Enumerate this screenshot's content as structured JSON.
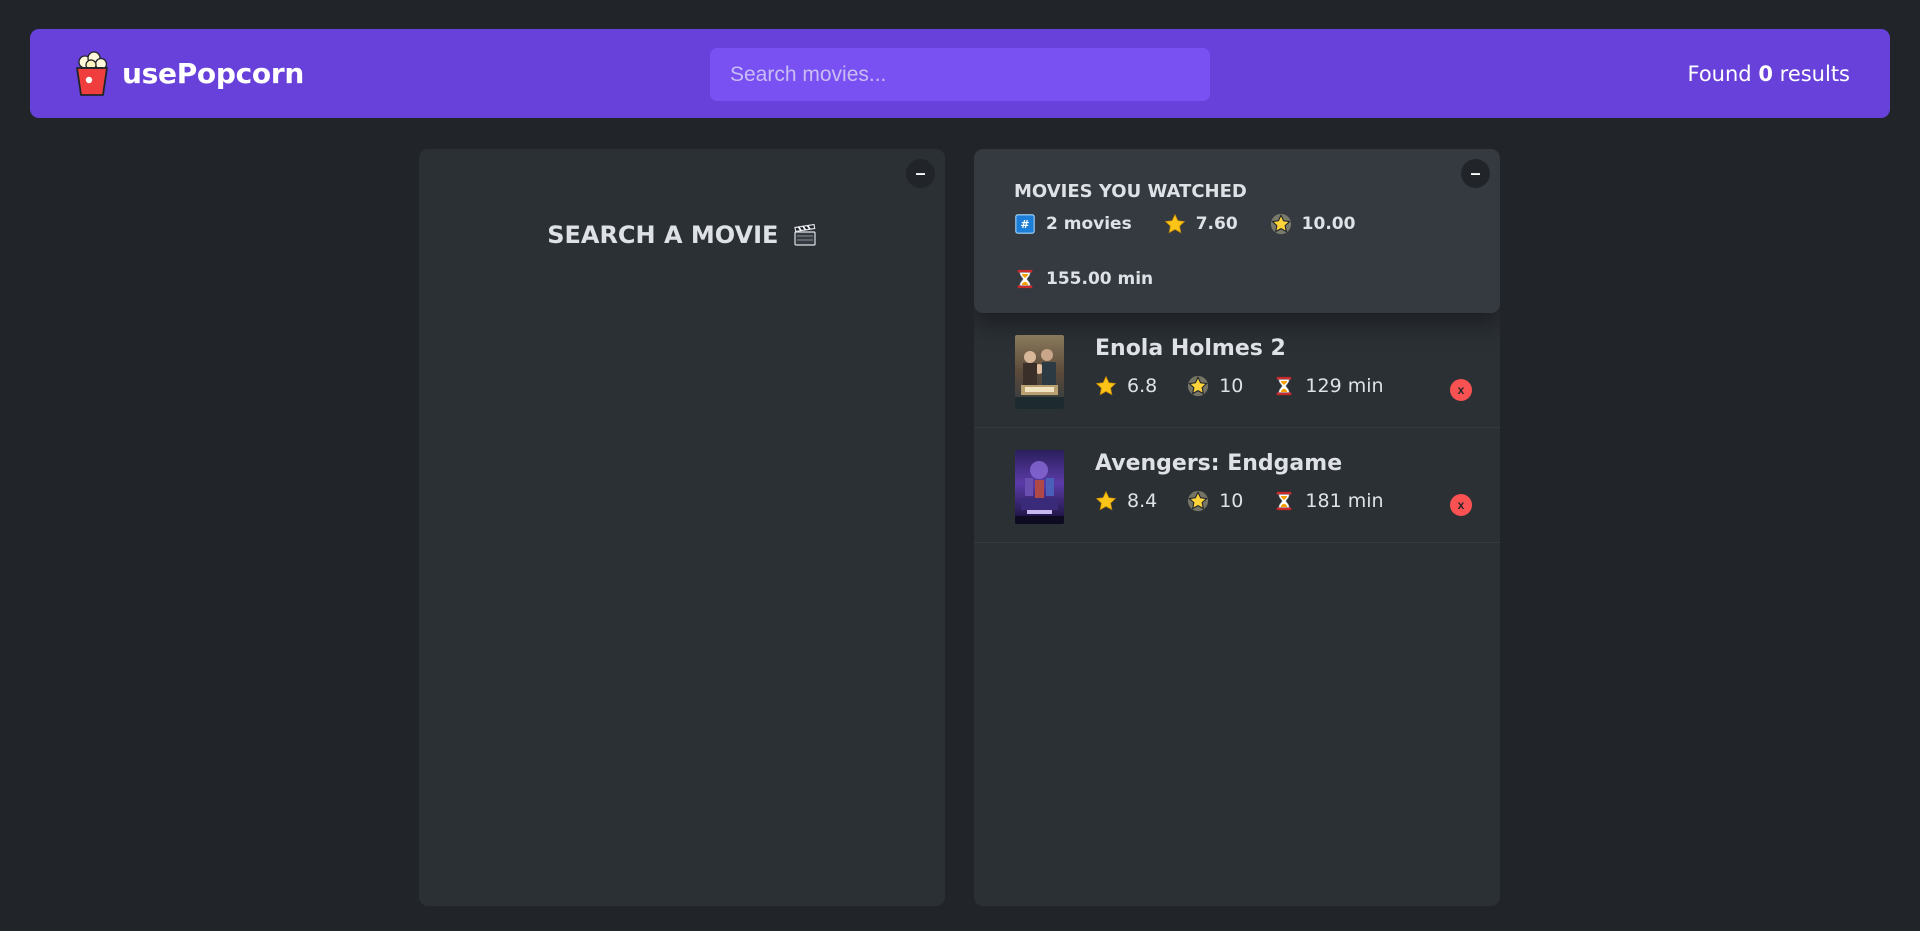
{
  "nav": {
    "logo_text": "usePopcorn",
    "search_placeholder": "Search movies...",
    "results_prefix": "Found",
    "results_count": "0",
    "results_suffix": "results"
  },
  "left_box": {
    "toggle_label": "–",
    "title": "SEARCH A MOVIE"
  },
  "right_box": {
    "toggle_label": "–",
    "summary": {
      "heading": "Movies you watched",
      "num_movies": "2 movies",
      "avg_imdb_rating": "7.60",
      "avg_user_rating": "10.00",
      "avg_runtime": "155.00 min"
    },
    "movies": [
      {
        "title": "Enola Holmes 2",
        "imdb_rating": "6.8",
        "user_rating": "10",
        "runtime": "129 min",
        "delete_label": "x"
      },
      {
        "title": "Avengers: Endgame",
        "imdb_rating": "8.4",
        "user_rating": "10",
        "runtime": "181 min",
        "delete_label": "x"
      }
    ]
  },
  "icons": {
    "logo": "popcorn-icon",
    "clapper": "clapper-board-icon",
    "count": "hash-icon",
    "imdb_rating": "star-icon",
    "user_rating": "glowing-star-icon",
    "runtime": "hourglass-icon"
  },
  "colors": {
    "nav_bg": "#6741d9",
    "search_bg": "#7950f2",
    "page_bg": "#212529",
    "box_bg": "#2b3035",
    "summary_bg": "#343a40",
    "delete_red": "#fa5252"
  }
}
